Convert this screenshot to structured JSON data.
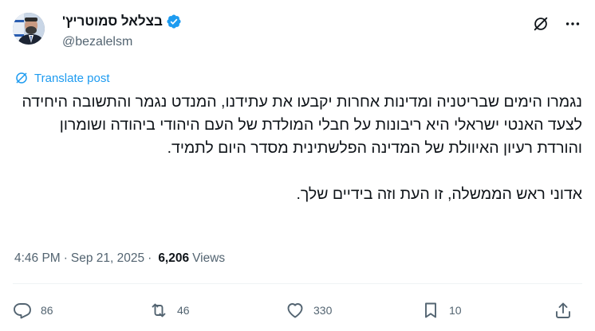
{
  "author": {
    "display_name": "בצלאל סמוטריץ'",
    "handle": "@bezalelsm",
    "verified_icon": "verified-badge-icon",
    "avatar": "author-avatar"
  },
  "header_actions": {
    "grok_icon": "grok-icon",
    "more_icon": "more-dots-icon"
  },
  "translate": {
    "label": "Translate post",
    "icon": "translate-globe-icon"
  },
  "tweet": {
    "text": "נגמרו הימים שבריטניה ומדינות אחרות יקבעו את עתידנו, המנדט נגמר והתשובה היחידה לצעד האנטי ישראלי היא ריבונות על חבלי המולדת של העם היהודי ביהודה ושומרון והורדת רעיון האיוולת של המדינה הפלשתינית מסדר היום לתמיד.\n\nאדוני ראש הממשלה, זו העת וזה בידיים שלך."
  },
  "meta": {
    "time": "4:46 PM",
    "separator": "·",
    "date": "Sep 21, 2025",
    "views_count": "6,206",
    "views_label": "Views"
  },
  "actions": {
    "replies": "86",
    "reposts": "46",
    "likes": "330",
    "bookmarks": "10",
    "reply_icon": "reply-icon",
    "repost_icon": "repost-icon",
    "like_icon": "heart-icon",
    "bookmark_icon": "bookmark-icon",
    "share_icon": "share-icon"
  },
  "colors": {
    "accent": "#1d9bf0",
    "text": "#0f1419",
    "secondary": "#536471",
    "divider": "#eff3f4"
  }
}
